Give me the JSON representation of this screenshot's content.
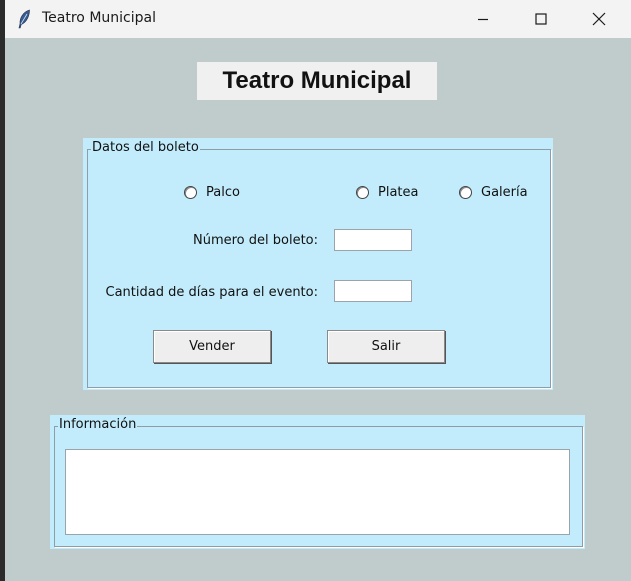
{
  "window": {
    "title": "Teatro Municipal",
    "icon": "feather-icon",
    "controls": [
      "minimize-icon",
      "maximize-icon",
      "close-icon"
    ]
  },
  "heading": "Teatro Municipal",
  "datos": {
    "legend": "Datos del boleto",
    "options": [
      "Palco",
      "Platea",
      "Galería"
    ],
    "numero_label": "Número del boleto:",
    "numero_value": "",
    "dias_label": "Cantidad de días para el evento:",
    "dias_value": "",
    "vender_label": "Vender",
    "salir_label": "Salir"
  },
  "info": {
    "legend": "Información",
    "text": ""
  },
  "colors": {
    "window_bg": "#c0cbcb",
    "panel_bg": "#c2ecfb",
    "titlebar_bg": "#f3f3f3"
  }
}
